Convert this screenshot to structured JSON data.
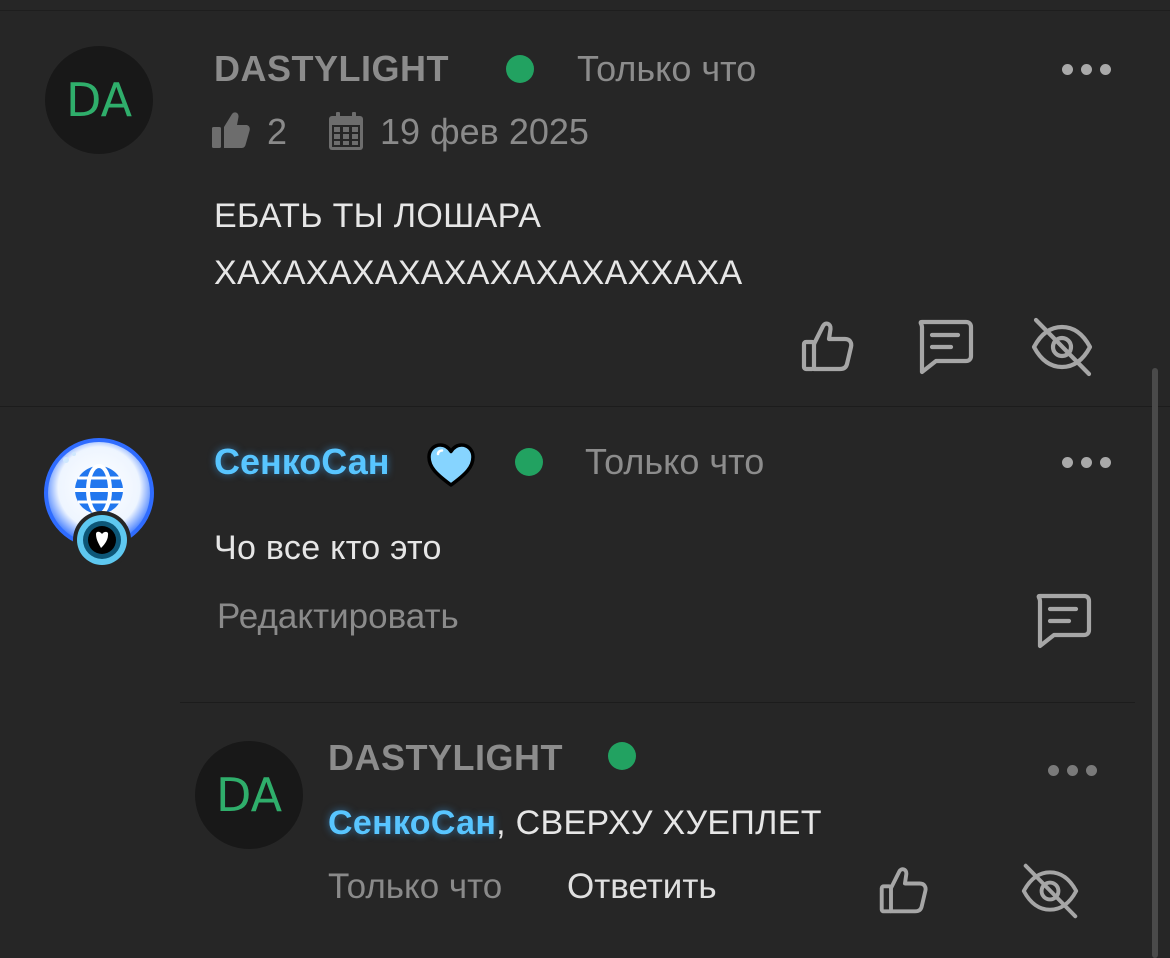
{
  "comments": [
    {
      "avatar_initials": "DA",
      "username": "DASTYLIGHT",
      "time": "Только что",
      "likes": "2",
      "date": "19 фев 2025",
      "text_line1": "ЕБАТЬ ТЫ ЛОШАРА",
      "text_line2": "ХАХАХАХАХАХАХАХАХАХХАХА"
    },
    {
      "username": "СенкоСан",
      "time": "Только что",
      "text": "Чо все кто это",
      "edit_label": "Редактировать"
    }
  ],
  "reply": {
    "avatar_initials": "DA",
    "username": "DASTYLIGHT",
    "mention": "СенкоСан",
    "text": ", СВЕРХУ ХУЕПЛЕТ",
    "time": "Только что",
    "reply_label": "Ответить"
  },
  "colors": {
    "background": "#262626",
    "online": "#22a261",
    "mention": "#58c5ff",
    "initials": "#2fae6b"
  },
  "icons": [
    "thumb-up-icon",
    "calendar-icon",
    "comment-icon",
    "eye-off-icon",
    "heart-icon",
    "more-icon",
    "globe-icon",
    "badge-icon"
  ]
}
